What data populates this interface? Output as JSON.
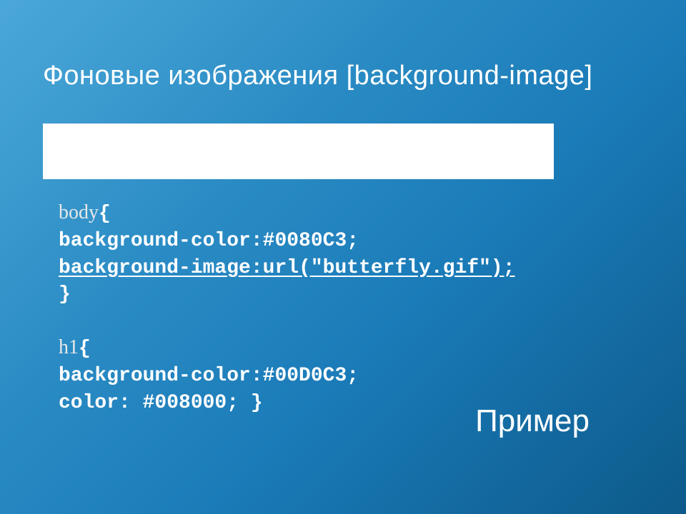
{
  "title": "Фоновые изображения [background-image]",
  "code": {
    "block1_selector": "body",
    "block1_brace_open": "{",
    "block1_line1": "background-color:#0080C3;",
    "block1_line2": "background-image:url(\"butterfly.gif\"); ",
    "block1_brace_close": "}",
    "block2_selector": "h1",
    "block2_brace_open": "{",
    "block2_line1": "background-color:#00D0C3;",
    "block2_line2": "color: #008000; }"
  },
  "exampleLabel": "Пример"
}
